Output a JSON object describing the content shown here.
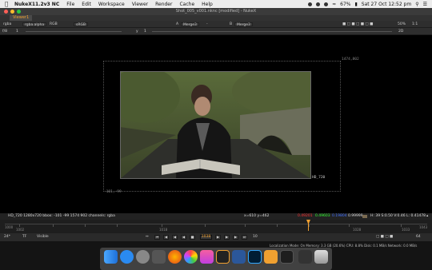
{
  "menubar": {
    "app_name": "NukeX11.2v3 NC",
    "items": [
      "File",
      "Edit",
      "Workspace",
      "Viewer",
      "Render",
      "Cache",
      "Help"
    ],
    "battery": "67%",
    "clock": "Sat 27 Oct 12:52 pm"
  },
  "window": {
    "title": "Shot_005_v001.nknc [modified] - NukeX"
  },
  "tab": {
    "label": "Viewer1"
  },
  "toolbar1": {
    "channels": "rgba",
    "alpha": "rgba.alpha",
    "display": "RGB",
    "colorspace": "sRGB",
    "input_a": "A",
    "input_a_value": "Merge3",
    "dash": "-",
    "input_b": "B",
    "input_b_value": "Merge3",
    "zoom": "50%",
    "ratio": "1:1"
  },
  "toolbar2": {
    "frame_skip": "f/8",
    "gain_value": "1",
    "gamma_label": "y",
    "gamma_value": "1",
    "right_value": "2D"
  },
  "viewport": {
    "format_label": "HD_720",
    "bbox_tr": "1474,802",
    "bbox_bl": "-101,-99"
  },
  "infobar": {
    "left": "HD_720 1280x720  bbox: -101 -99 1574 902 channels: rgba",
    "coords": "x=610 y=462",
    "r": "0.49201",
    "g": "0.49603",
    "b": "0.19804",
    "a": "0.99999",
    "hsv": "H: 39 S:0.50 V:0.46  L: 0.41478"
  },
  "timeline": {
    "ticks": [
      "1002",
      "1018",
      "1028",
      "1033"
    ],
    "start": "1000",
    "end": "1043"
  },
  "playbar": {
    "fps": "24*",
    "tf": "TF",
    "visible": "Visible",
    "current_frame": "1038",
    "skip": "10",
    "end_frame": "64"
  },
  "status": {
    "text": "Localization Mode: On  Memory: 3.3 GB (20.6%)  CPU: 8.8%  Disk: 0.1 MB/s  Network: 0.0 MB/s"
  },
  "colors": {
    "accent": "#f0a030",
    "r": "#ff3030",
    "g": "#30ff30",
    "b": "#4070ff"
  },
  "dock": {
    "icons": [
      "finder-icon",
      "safari-icon",
      "system-prefs-icon",
      "launchpad-icon",
      "firefox-icon",
      "photos-icon",
      "itunes-icon",
      "nuke-icon",
      "word-icon",
      "photoshop-icon",
      "nuke-x-icon",
      "app-icon",
      "movie-icon",
      "trash-icon"
    ]
  }
}
